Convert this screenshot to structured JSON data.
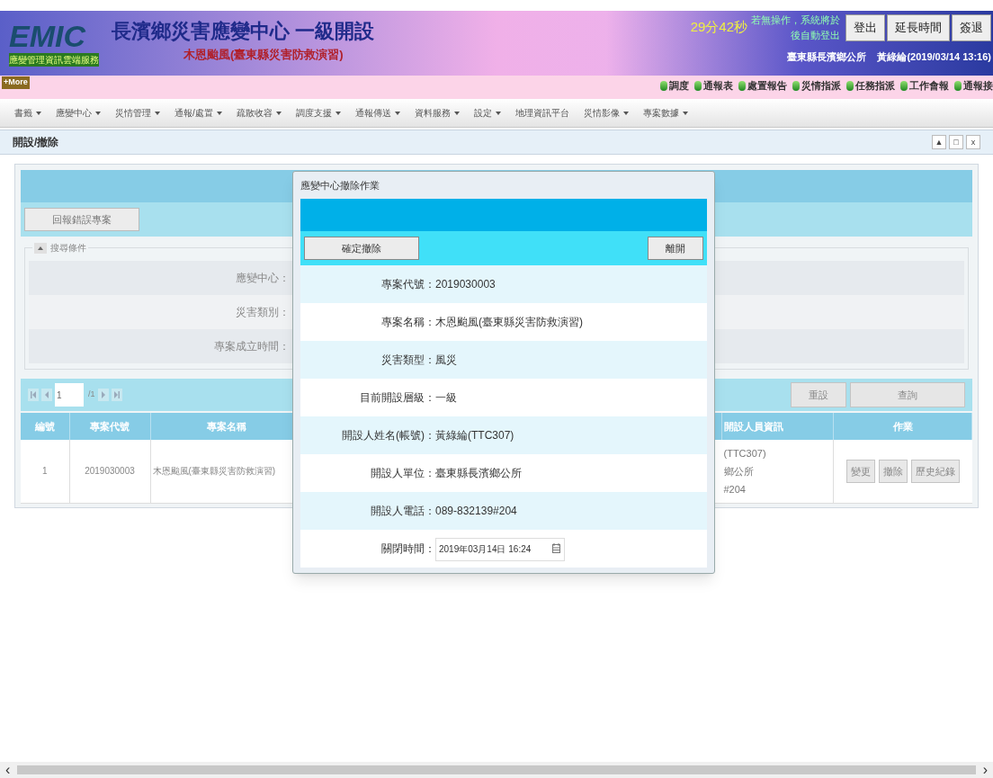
{
  "header": {
    "logo_text": "EMIC",
    "logo_subtitle": "應變管理資訊雲端服務",
    "more_badge": "+More",
    "title": "長濱鄉災害應變中心 一級開設",
    "subtitle": "木恩颱風(臺東縣災害防救演習)",
    "logout_notice": {
      "line1": "若無操作，系統將於",
      "countdown": "29分42秒",
      "line2": "後自動登出"
    },
    "buttons": [
      "登出",
      "延長時間",
      "簽退"
    ],
    "user_info": {
      "org": "臺東縣長濱鄉公所",
      "user": "黃綠綸(2019/03/14 13:16)"
    },
    "quick_links": [
      {
        "label": "調度"
      },
      {
        "label": "通報表"
      },
      {
        "label": "處置報告"
      },
      {
        "label": "災情指派"
      },
      {
        "label": "任務指派"
      },
      {
        "label": "工作會報"
      },
      {
        "label": "通報接"
      }
    ]
  },
  "menu": [
    {
      "label": "書籤",
      "dropdown": true
    },
    {
      "label": "應變中心",
      "dropdown": true
    },
    {
      "label": "災情管理",
      "dropdown": true
    },
    {
      "label": "通報/處置",
      "dropdown": true
    },
    {
      "label": "疏散收容",
      "dropdown": true
    },
    {
      "label": "調度支援",
      "dropdown": true
    },
    {
      "label": "通報傳送",
      "dropdown": true
    },
    {
      "label": "資料服務",
      "dropdown": true
    },
    {
      "label": "設定",
      "dropdown": true
    },
    {
      "label": "地理資訊平台",
      "dropdown": false
    },
    {
      "label": "災情影像",
      "dropdown": true
    },
    {
      "label": "專案數據",
      "dropdown": true
    }
  ],
  "page": {
    "title": "開設/撤除",
    "window_controls": [
      "▲",
      "□",
      "x"
    ]
  },
  "panel": {
    "report_button": "回報錯誤專案",
    "search": {
      "legend": "搜尋條件",
      "expanded": true,
      "fields": [
        {
          "label": "應變中心："
        },
        {
          "label": "災害類別："
        },
        {
          "label": "專案成立時間："
        }
      ]
    },
    "pager": {
      "page_input": "1",
      "page_total": "/1"
    },
    "actions": [
      "重設",
      "查詢"
    ],
    "table": {
      "columns": [
        "編號",
        "專案代號",
        "專案名稱",
        "開設人員資訊",
        "作業"
      ],
      "rows": [
        {
          "number": "1",
          "code": "2019030003",
          "name": "木恩颱風(臺東縣災害防救演習)",
          "info_lines": [
            "(TTC307)",
            "鄉公所",
            "#204"
          ],
          "actions": [
            "變更",
            "撤除",
            "歷史紀錄"
          ]
        }
      ]
    }
  },
  "dialog": {
    "title": "應變中心撤除作業",
    "confirm_button": "確定撤除",
    "close_button": "離開",
    "fields": [
      {
        "label": "專案代號：",
        "value": "2019030003"
      },
      {
        "label": "專案名稱：",
        "value": "木恩颱風(臺東縣災害防救演習)"
      },
      {
        "label": "災害類型：",
        "value": "風災"
      },
      {
        "label": "目前開設層級：",
        "value": "一級"
      },
      {
        "label": "開設人姓名(帳號)：",
        "value": "黃綠綸(TTC307)"
      },
      {
        "label": "開設人單位：",
        "value": "臺東縣長濱鄉公所"
      },
      {
        "label": "開設人電話：",
        "value": "089-832139#204"
      }
    ],
    "close_time": {
      "label": "關閉時間：",
      "value": "2019年03月14日 16:24"
    }
  },
  "scrollbar": {
    "left": "‹",
    "right": "›"
  }
}
